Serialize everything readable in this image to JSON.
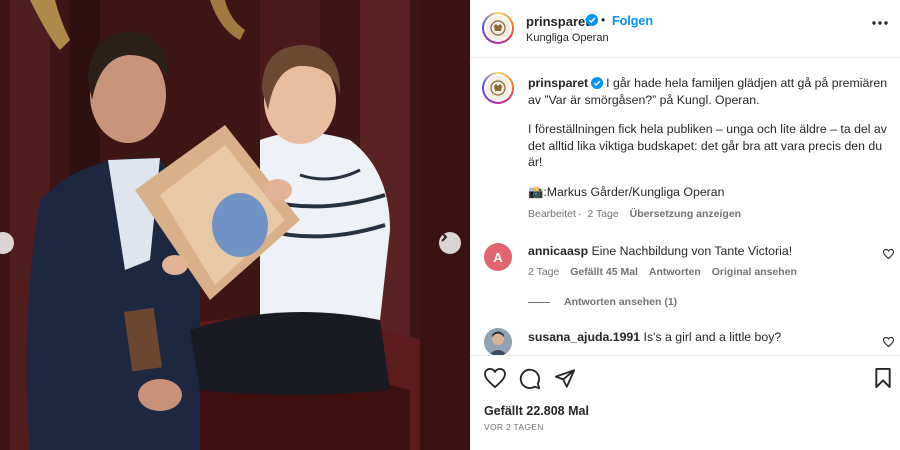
{
  "post": {
    "username": "prinsparet",
    "follow_label": "Folgen",
    "dot": "•",
    "location": "Kungliga Operan"
  },
  "caption": {
    "username": "prinsparet",
    "paragraph1": "I går hade hela familjen glädjen att gå på premiären av ”Var är smörgåsen?” på Kungl. Operan.",
    "paragraph2": "I föreställningen fick hela publiken – unga och lite äldre – ta del av det alltid lika viktiga budskapet: det går bra att vara precis den du är!",
    "photo_credit_emoji": "📸",
    "photo_credit": ":Markus Gårder/Kungliga Operan",
    "edited": "Bearbeitet",
    "time": "2 Tage",
    "translate": "Übersetzung anzeigen"
  },
  "comments": [
    {
      "username": "annicaasp",
      "text": "Eine Nachbildung von Tante Victoria!",
      "time": "2 Tage",
      "likes": "Gefällt 45 Mal",
      "reply": "Antworten",
      "original": "Original ansehen",
      "avatar_letter": "A",
      "avatar_color": "#e2646f"
    },
    {
      "username": "susana_ajuda.1991",
      "text": "Is's a girl and a little boy?"
    }
  ],
  "view_replies": "Antworten ansehen (1)",
  "likes": "Gefällt 22.808 Mal",
  "time_ago": "VOR 2 TAGEN",
  "colors": {
    "accent": "#0095f6",
    "verified": "#0095f6",
    "text": "#262626",
    "muted": "#737373"
  },
  "icons": [
    "verified-badge-icon",
    "more-icon",
    "heart-icon",
    "comment-icon",
    "share-icon",
    "bookmark-icon",
    "chevron-left-icon",
    "chevron-right-icon"
  ]
}
